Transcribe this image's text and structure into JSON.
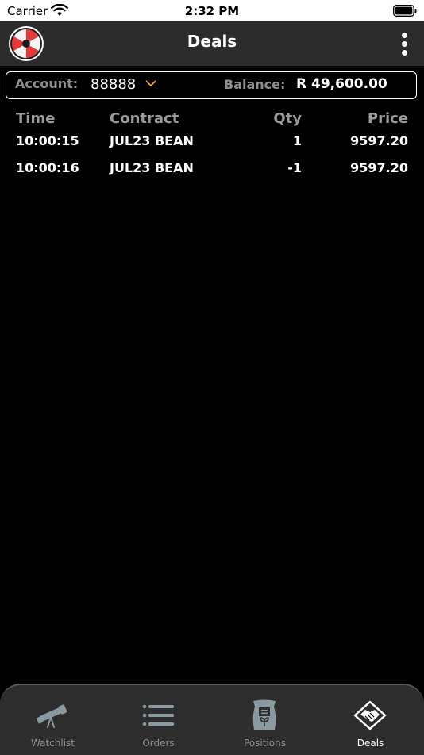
{
  "status_bar": {
    "carrier": "Carrier",
    "time": "2:32 PM"
  },
  "nav": {
    "title": "Deals"
  },
  "account_bar": {
    "account_label": "Account:",
    "account_value": "88888",
    "balance_label": "Balance:",
    "balance_value": "R 49,600.00"
  },
  "table": {
    "columns": [
      "Time",
      "Contract",
      "Qty",
      "Price"
    ],
    "rows": [
      {
        "time": "10:00:15",
        "contract": "JUL23 BEAN",
        "qty": "1",
        "price": "9597.20"
      },
      {
        "time": "10:00:16",
        "contract": "JUL23 BEAN",
        "qty": "-1",
        "price": "9597.20"
      }
    ]
  },
  "tabs": [
    {
      "label": "Watchlist",
      "icon": "telescope-icon"
    },
    {
      "label": "Orders",
      "icon": "list-icon"
    },
    {
      "label": "Positions",
      "icon": "grain-sack-icon"
    },
    {
      "label": "Deals",
      "icon": "handshake-icon",
      "active": true
    }
  ],
  "colors": {
    "background": "#000000",
    "nav_background": "#2c2c2c",
    "accent_chevron": "#f2a23a",
    "logo_red": "#e63a3a",
    "muted_text": "#8e8e8e"
  }
}
